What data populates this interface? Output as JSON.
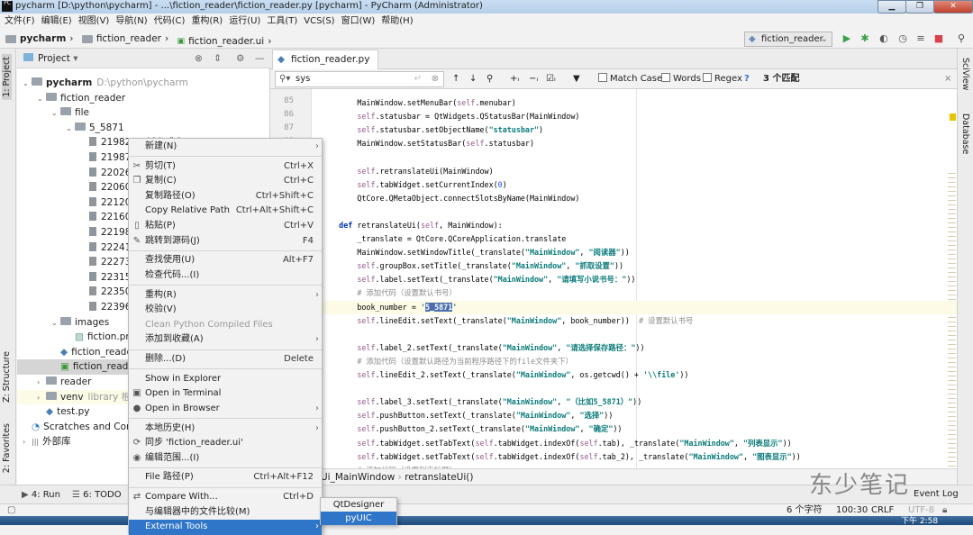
{
  "window": {
    "title": "pycharm [D:\\python\\pycharm] - ...\\fiction_reader\\fiction_reader.py [pycharm] - PyCharm (Administrator)",
    "logo": "PC"
  },
  "menubar": [
    "文件(F)",
    "编辑(E)",
    "视图(V)",
    "导航(N)",
    "代码(C)",
    "重构(R)",
    "运行(U)",
    "工具(T)",
    "VCS(S)",
    "窗口(W)",
    "帮助(H)"
  ],
  "breadcrumb": [
    "pycharm",
    "fiction_reader",
    "fiction_reader.ui"
  ],
  "run_config": "fiction_reader",
  "toolbar_icons": [
    "run-icon",
    "debug-icon",
    "coverage-icon",
    "profile-icon",
    "concurrency-icon",
    "stop-icon",
    "search-icon"
  ],
  "left_strip": {
    "project": "1: Project",
    "structure": "Z: Structure",
    "favorites": "2: Favorites"
  },
  "right_strip": {
    "sciview": "SciView",
    "database": "Database"
  },
  "project": {
    "title": "Project",
    "tree": [
      {
        "label": "pycharm",
        "hint": "D:\\python\\pycharm",
        "type": "folder",
        "depth": 0,
        "expanded": true
      },
      {
        "label": "fiction_reader",
        "type": "folder",
        "depth": 1,
        "expanded": true
      },
      {
        "label": "file",
        "type": "folder",
        "depth": 2,
        "expanded": true
      },
      {
        "label": "5_5871",
        "type": "folder",
        "depth": 3,
        "expanded": true
      },
      {
        "label": "2198283 新书感言.txt",
        "type": "file",
        "depth": 4
      },
      {
        "label": "21987",
        "type": "file",
        "depth": 4
      },
      {
        "label": "22026",
        "type": "file",
        "depth": 4
      },
      {
        "label": "22060",
        "type": "file",
        "depth": 4
      },
      {
        "label": "22120",
        "type": "file",
        "depth": 4
      },
      {
        "label": "22160",
        "type": "file",
        "depth": 4
      },
      {
        "label": "22198",
        "type": "file",
        "depth": 4
      },
      {
        "label": "22241",
        "type": "file",
        "depth": 4
      },
      {
        "label": "22273",
        "type": "file",
        "depth": 4
      },
      {
        "label": "22315",
        "type": "file",
        "depth": 4
      },
      {
        "label": "22350",
        "type": "file",
        "depth": 4
      },
      {
        "label": "22396",
        "type": "file",
        "depth": 4
      },
      {
        "label": "images",
        "type": "folder",
        "depth": 2,
        "expanded": true
      },
      {
        "label": "fiction.png",
        "type": "image",
        "depth": 3
      },
      {
        "label": "fiction_reader",
        "type": "python",
        "depth": 2
      },
      {
        "label": "fiction_reader",
        "type": "ui",
        "depth": 2,
        "selected": true
      },
      {
        "label": "reader",
        "type": "folder",
        "depth": 1,
        "expanded": false
      },
      {
        "label": "venv",
        "hint": "library 根",
        "type": "folder",
        "depth": 1,
        "expanded": false,
        "library": true
      },
      {
        "label": "test.py",
        "type": "python",
        "depth": 1
      },
      {
        "label": "Scratches and Conso",
        "type": "scratch",
        "depth": 0
      },
      {
        "label": "外部库",
        "type": "lib",
        "depth": 0,
        "expanded": false
      }
    ]
  },
  "editor": {
    "tab": "fiction_reader.py",
    "search": {
      "value": "sys",
      "match_case": "Match Case",
      "words": "Words",
      "regex": "Regex",
      "help": "?",
      "matches": "3 个匹配"
    },
    "first_line": 85,
    "current_line": 100,
    "lines": [
      "        MainWindow.setMenuBar(self.menubar)",
      "        self.statusbar = QtWidgets.QStatusBar(MainWindow)",
      "        self.statusbar.setObjectName(\"statusbar\")",
      "        MainWindow.setStatusBar(self.statusbar)",
      "",
      "        self.retranslateUi(MainWindow)",
      "        self.tabWidget.setCurrentIndex(0)",
      "        QtCore.QMetaObject.connectSlotsByName(MainWindow)",
      "",
      "    def retranslateUi(self, MainWindow):",
      "        _translate = QtCore.QCoreApplication.translate",
      "        MainWindow.setWindowTitle(_translate(\"MainWindow\", \"阅读器\"))",
      "        self.groupBox.setTitle(_translate(\"MainWindow\", \"抓取设置\"))",
      "        self.label.setText(_translate(\"MainWindow\", \"请填写小说书号：\"))",
      "        # 添加代码（设置默认书号）",
      "        book_number = '5_5871'",
      "        self.lineEdit.setText(_translate(\"MainWindow\", book_number))  # 设置默认书号",
      "",
      "        self.label_2.setText(_translate(\"MainWindow\", \"请选择保存路径：\"))",
      "        # 添加代码（设置默认路径为当前程序路径下的file文件夹下）",
      "        self.lineEdit_2.setText(_translate(\"MainWindow\", os.getcwd() + '\\\\file'))",
      "",
      "        self.label_3.setText(_translate(\"MainWindow\", \"（比如5_5871）\"))",
      "        self.pushButton.setText(_translate(\"MainWindow\", \"选择\"))",
      "        self.pushButton_2.setText(_translate(\"MainWindow\", \"确定\"))",
      "        self.tabWidget.setTabText(self.tabWidget.indexOf(self.tab), _translate(\"MainWindow\", \"列表显示\"))",
      "        self.tabWidget.setTabText(self.tabWidget.indexOf(self.tab_2), _translate(\"MainWindow\", \"图表显示\"))",
      "        # 添加代码（设置列表标题）"
    ],
    "selection": "5_5871",
    "crumb": [
      "Ui_MainWindow",
      "retranslateUi()"
    ]
  },
  "context_menu": [
    {
      "label": "新建(N)",
      "submenu": true
    },
    {
      "sep": true
    },
    {
      "label": "剪切(T)",
      "shortcut": "Ctrl+X",
      "icon": "✂",
      "icon_name": "cut-icon"
    },
    {
      "label": "复制(C)",
      "shortcut": "Ctrl+C",
      "icon": "❐",
      "icon_name": "copy-icon"
    },
    {
      "label": "复制路径(O)",
      "shortcut": "Ctrl+Shift+C"
    },
    {
      "label": "Copy Relative Path",
      "shortcut": "Ctrl+Alt+Shift+C"
    },
    {
      "label": "粘贴(P)",
      "shortcut": "Ctrl+V",
      "icon": "▯",
      "icon_name": "paste-icon"
    },
    {
      "label": "跳转到源码(J)",
      "shortcut": "F4",
      "icon": "✎",
      "icon_name": "edit-source-icon"
    },
    {
      "sep": true
    },
    {
      "label": "查找使用(U)",
      "shortcut": "Alt+F7"
    },
    {
      "label": "检查代码...(I)"
    },
    {
      "sep": true
    },
    {
      "label": "重构(R)",
      "submenu": true
    },
    {
      "label": "校验(V)"
    },
    {
      "label": "Clean Python Compiled Files",
      "disabled": true
    },
    {
      "label": "添加到收藏(A)",
      "submenu": true
    },
    {
      "sep": true
    },
    {
      "label": "删除...(D)",
      "shortcut": "Delete"
    },
    {
      "sep": true
    },
    {
      "label": "Show in Explorer"
    },
    {
      "label": "Open in Terminal",
      "icon": "▣",
      "icon_name": "terminal-icon"
    },
    {
      "label": "Open in Browser",
      "submenu": true,
      "icon": "●",
      "icon_name": "browser-icon"
    },
    {
      "sep": true
    },
    {
      "label": "本地历史(H)",
      "submenu": true
    },
    {
      "label": "同步 'fiction_reader.ui'",
      "icon": "⟳",
      "icon_name": "sync-icon"
    },
    {
      "label": "编辑范围...(I)",
      "icon": "◉",
      "icon_name": "scope-icon"
    },
    {
      "sep": true
    },
    {
      "label": "File 路径(P)",
      "shortcut": "Ctrl+Alt+F12"
    },
    {
      "sep": true
    },
    {
      "label": "Compare With...",
      "shortcut": "Ctrl+D",
      "icon": "⇄",
      "icon_name": "compare-icon"
    },
    {
      "label": "与编辑器中的文件比较(M)"
    },
    {
      "label": "External Tools",
      "submenu": true,
      "active": true
    }
  ],
  "submenu": [
    {
      "label": "QtDesigner"
    },
    {
      "label": "pyUIC",
      "active": true
    }
  ],
  "bottom_tools": {
    "run": "4: Run",
    "todo": "6: TODO",
    "event_log": "Event Log"
  },
  "status": {
    "chars": "6 个字符",
    "position": "100:30",
    "line_sep": "CRLF",
    "encoding": "UTF-8"
  },
  "taskbar": {
    "clock": "下午 2:58"
  },
  "watermark": "东少笔记",
  "colors": {
    "accent": "#2f76c9",
    "selection": "#4a6eb0",
    "string": "#0a7a7a",
    "self": "#94558d"
  }
}
